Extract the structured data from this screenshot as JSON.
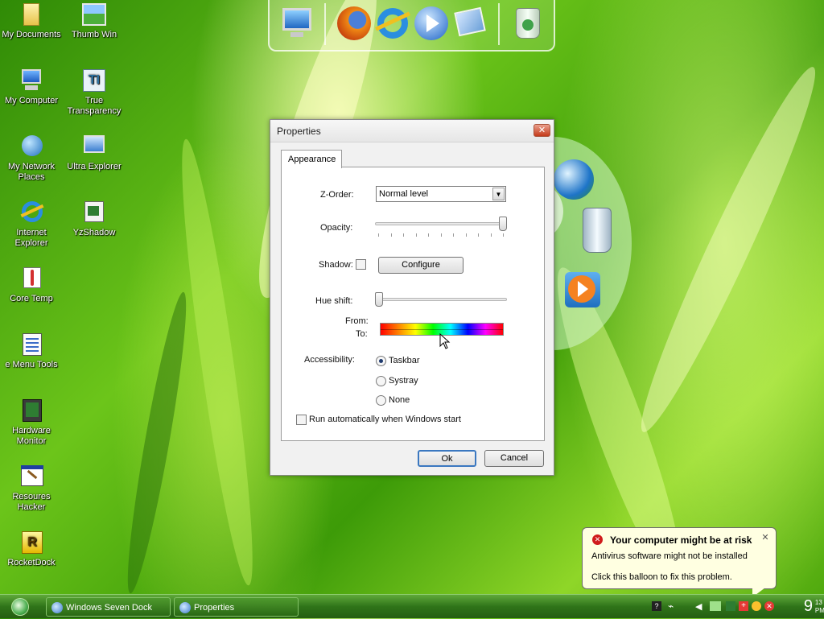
{
  "desktop_icons": [
    {
      "label": "My Documents",
      "icon": "folder-documents-icon"
    },
    {
      "label": "Thumb Win",
      "icon": "landscape-window-icon"
    },
    {
      "label": "My Computer",
      "icon": "computer-icon"
    },
    {
      "label": "True Transparency",
      "icon": "tt-app-icon"
    },
    {
      "label": "My Network Places",
      "icon": "network-globe-icon"
    },
    {
      "label": "Ultra Explorer",
      "icon": "ultra-explorer-icon"
    },
    {
      "label": "Internet Explorer",
      "icon": "internet-explorer-icon"
    },
    {
      "label": "YzShadow",
      "icon": "yzshadow-icon"
    },
    {
      "label": "Core Temp",
      "icon": "thermometer-icon"
    },
    {
      "label": "e Menu Tools",
      "icon": "menu-tools-icon"
    },
    {
      "label": "Hardware Monitor",
      "icon": "hardware-monitor-icon"
    },
    {
      "label": "Resoures Hacker",
      "icon": "resource-hacker-icon"
    },
    {
      "label": "RocketDock",
      "icon": "rocketdock-icon"
    }
  ],
  "dock": {
    "items": [
      "monitor-icon",
      "firefox-icon",
      "internet-explorer-icon",
      "media-player-icon",
      "windows-tools-icon",
      "recycle-bin-icon"
    ]
  },
  "right_dock": {
    "items": [
      "globe-icon",
      "recycle-bin-icon",
      "media-player-icon"
    ]
  },
  "dialog": {
    "title": "Properties",
    "close_label": "✕",
    "tab": "Appearance",
    "z_order_label": "Z-Order:",
    "z_order_value": "Normal level",
    "opacity_label": "Opacity:",
    "opacity_value": 1.0,
    "shadow_label": "Shadow:",
    "shadow_checked": false,
    "configure_label": "Configure",
    "hue_shift_label": "Hue shift:",
    "hue_shift_value": 0.0,
    "from_label": "From:",
    "to_label": "To:",
    "accessibility_label": "Accessibility:",
    "accessibility_options": [
      "Taskbar",
      "Systray",
      "None"
    ],
    "accessibility_selected": "Taskbar",
    "autostart_label": "Run automatically when Windows start",
    "autostart_checked": false,
    "ok_label": "Ok",
    "cancel_label": "Cancel"
  },
  "balloon": {
    "title": "Your computer might be at risk",
    "line1": "Antivirus software might not be installed",
    "line2": "Click this balloon to fix this problem.",
    "close_label": "✕"
  },
  "taskbar": {
    "tasks": [
      "Windows Seven Dock",
      "Properties"
    ],
    "clock_hour": "9",
    "clock_minutes": "13",
    "clock_ampm": "PM"
  },
  "colors": {
    "desktop_green": "#4aa50c",
    "taskbar_green": "#2f7419",
    "balloon_bg": "#ffffe1",
    "close_red": "#c43a1a"
  }
}
